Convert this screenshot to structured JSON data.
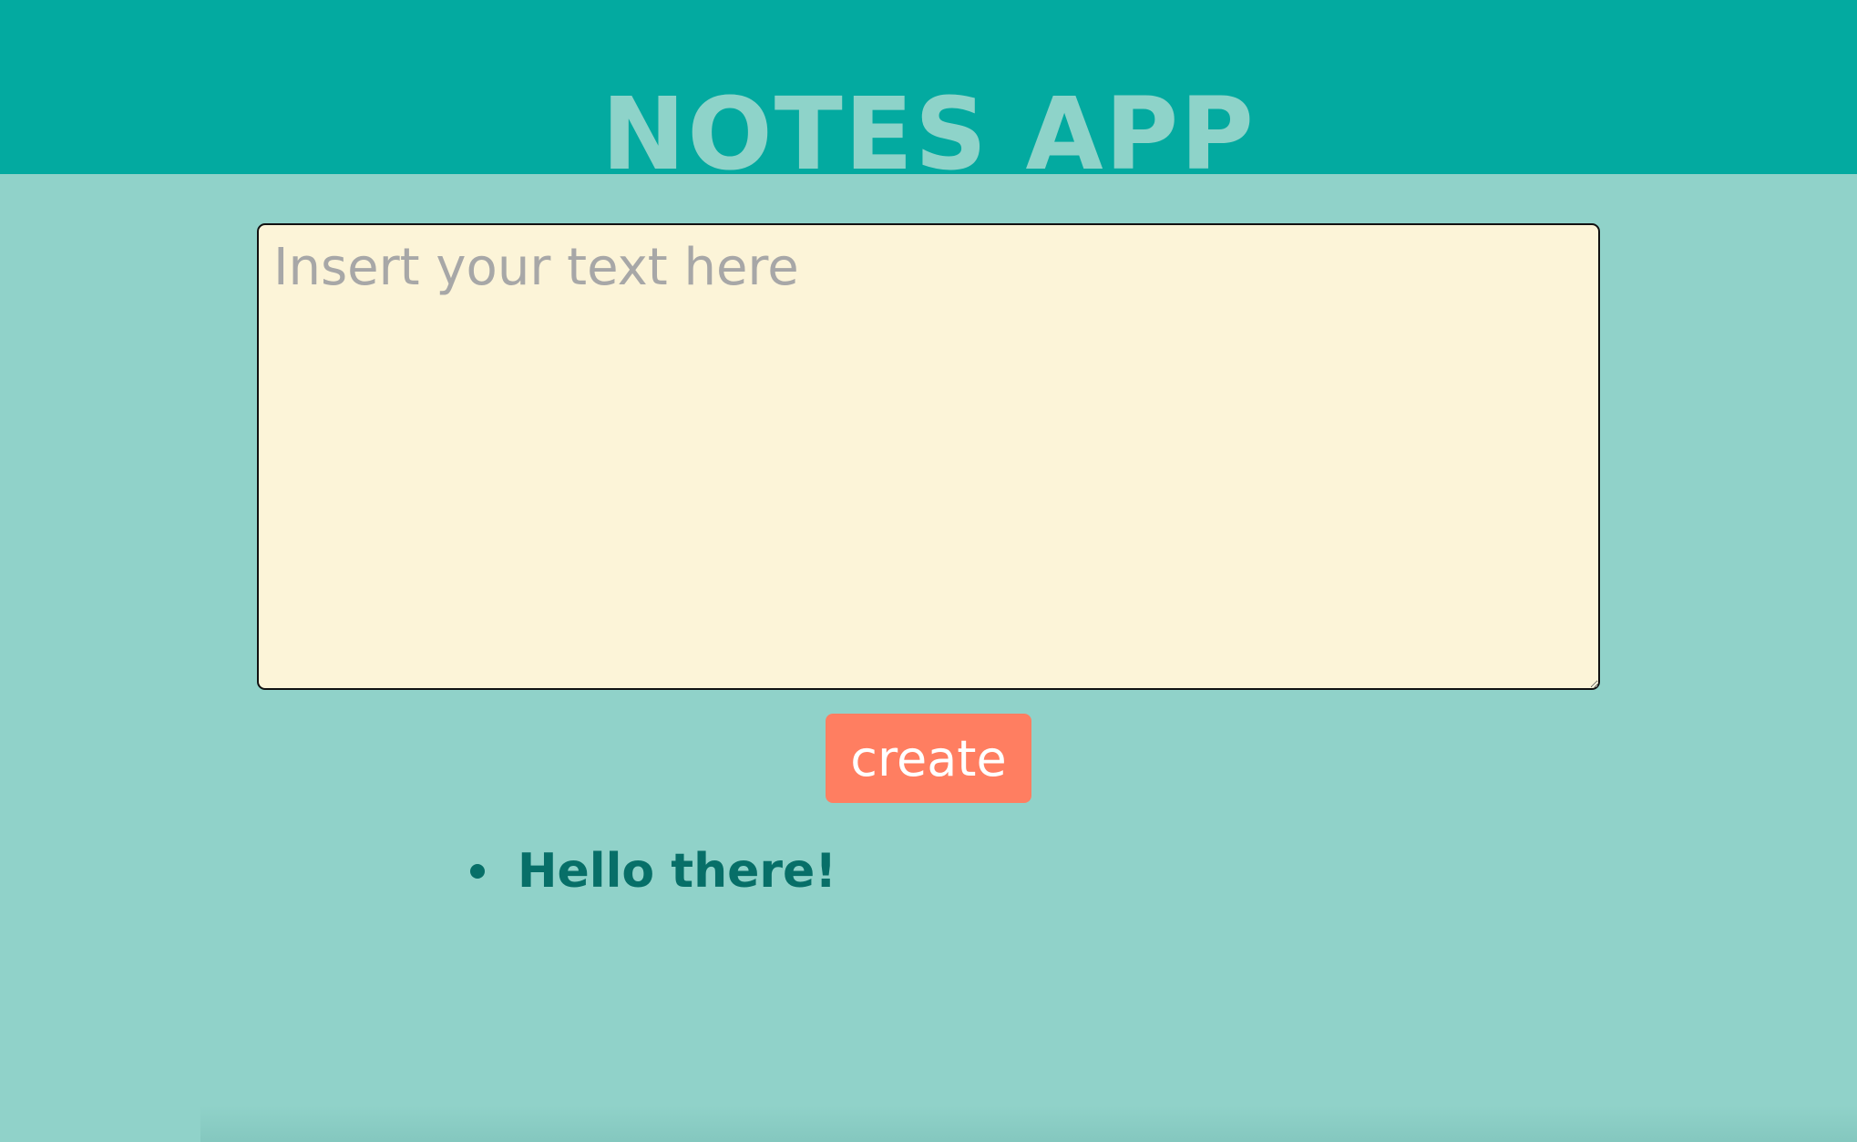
{
  "header": {
    "title": "NOTES APP"
  },
  "editor": {
    "placeholder": "Insert your text here",
    "value": ""
  },
  "actions": {
    "create_label": "create"
  },
  "notes": [
    {
      "text": "Hello there!"
    }
  ],
  "colors": {
    "header_bg": "#03aaa0",
    "page_bg": "#90d2c9",
    "title": "#8ed3c9",
    "editor_bg": "#fcf4d8",
    "button_bg": "#ff7e61",
    "note_text": "#076f68"
  }
}
